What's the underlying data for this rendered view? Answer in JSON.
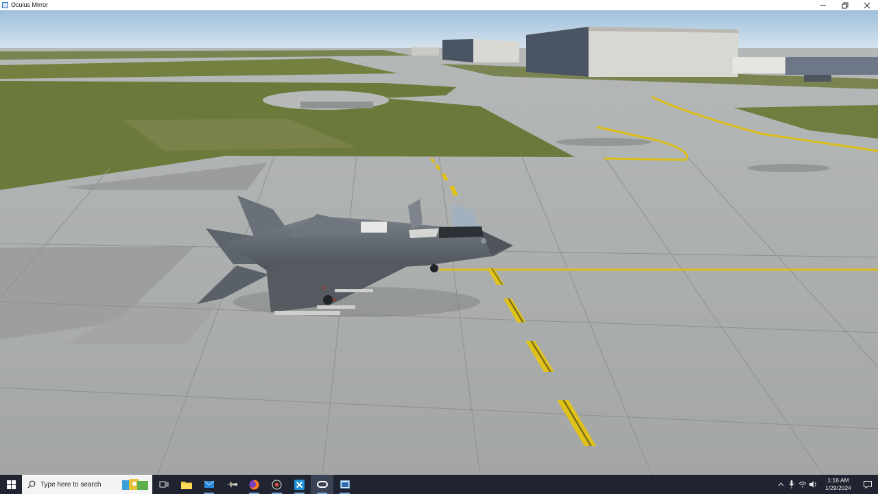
{
  "window": {
    "title": "Oculus Mirror",
    "minimize_icon": "minimize-icon",
    "restore_icon": "restore-icon",
    "close_icon": "close-icon"
  },
  "scene": {
    "description_icon": "flight-simulator-viewport",
    "colors": {
      "sky": "#b9d3e8",
      "concrete": "#a7aaa9",
      "grass": "#6d7a3c",
      "taxi_line": "#e0c21a",
      "jet": "#5d646b",
      "hangar": "#dcdbd6"
    }
  },
  "taskbar": {
    "search_placeholder": "Type here to search",
    "apps": [
      {
        "name": "task-view",
        "icon": "task-view-icon"
      },
      {
        "name": "file-explorer",
        "icon": "folder-icon"
      },
      {
        "name": "mail",
        "icon": "mail-icon"
      },
      {
        "name": "photos",
        "icon": "airplane-app-icon"
      },
      {
        "name": "firefox",
        "icon": "firefox-icon"
      },
      {
        "name": "obs",
        "icon": "record-icon"
      },
      {
        "name": "x-app",
        "icon": "x-app-icon"
      },
      {
        "name": "oculus",
        "icon": "oculus-icon"
      },
      {
        "name": "oculus-mirror",
        "icon": "mirror-window-icon"
      }
    ],
    "clock": {
      "time": "1:16 AM",
      "date": "1/29/2024"
    }
  }
}
